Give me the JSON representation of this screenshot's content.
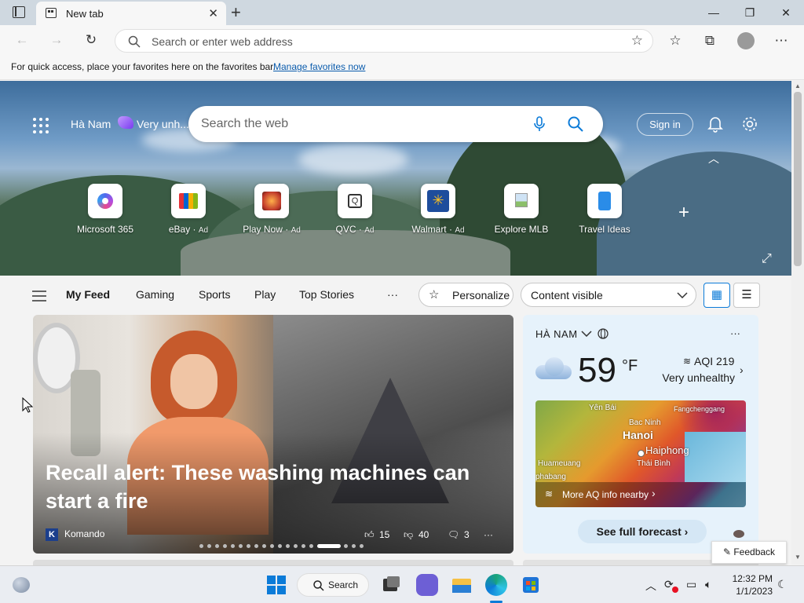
{
  "browser": {
    "tab_title": "New tab",
    "address_placeholder": "Search or enter web address"
  },
  "favorites_bar": {
    "message": "For quick access, place your favorites here on the favorites bar.",
    "link": "Manage favorites now"
  },
  "hero": {
    "location": "Hà Nam",
    "weather_summary": "Very unh...",
    "search_placeholder": "Search the web",
    "signin_label": "Sign in",
    "quick_links": [
      {
        "name": "Microsoft 365",
        "ad": ""
      },
      {
        "name": "eBay",
        "ad": "Ad"
      },
      {
        "name": "Play Now",
        "ad": "Ad"
      },
      {
        "name": "QVC",
        "ad": "Ad"
      },
      {
        "name": "Walmart",
        "ad": "Ad"
      },
      {
        "name": "Explore MLB",
        "ad": ""
      },
      {
        "name": "Travel Ideas",
        "ad": ""
      }
    ]
  },
  "feed_nav": {
    "items": [
      "My Feed",
      "Gaming",
      "Sports",
      "Play",
      "Top Stories"
    ],
    "more": "···",
    "personalize": "Personalize",
    "content_visible": "Content visible"
  },
  "main_card": {
    "title": "Recall alert: These washing machines can start a fire",
    "source": "Komando",
    "source_initial": "K",
    "likes": "15",
    "dislikes": "40",
    "comments": "3",
    "more": "···",
    "slide_count": 19,
    "active_slide": 15
  },
  "weather": {
    "location": "HÀ NAM",
    "temperature": "59",
    "unit": "°F",
    "aqi": "AQI 219",
    "aqi_status": "Very unhealthy",
    "map_labels": [
      "Yên Bái",
      "Fangchenggang",
      "Bac Ninh",
      "Hanoi",
      "Haiphong",
      "Huameuang",
      "Thái Bình",
      "phabang"
    ],
    "map_link": "More AQ info nearby",
    "forecast_button": "See full forecast",
    "more": "···"
  },
  "feedback_label": "Feedback",
  "taskbar": {
    "search_label": "Search",
    "time": "12:32 PM",
    "date": "1/1/2023"
  },
  "colors": {
    "accent": "#0b5cad",
    "edge_blue": "#0c7bd8",
    "hero_sky": "#6f9bc6"
  }
}
